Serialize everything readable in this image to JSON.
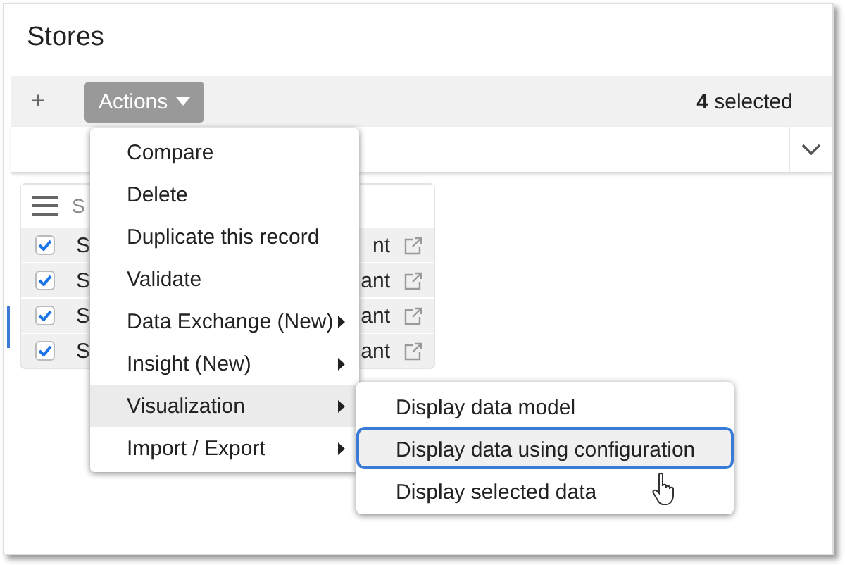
{
  "title": "Stores",
  "toolbar": {
    "add": "+",
    "actions": "Actions",
    "selected": "**4** selected"
  },
  "table": {
    "header": "S",
    "rows": [
      {
        "checked": true,
        "name": "S",
        "type": "nt"
      },
      {
        "checked": true,
        "name": "S",
        "type": "ant"
      },
      {
        "checked": true,
        "name": "S",
        "type": "ant"
      },
      {
        "checked": true,
        "name": "S",
        "type": "ant"
      }
    ]
  },
  "menu": {
    "items": [
      {
        "label": "Compare",
        "submenu": false,
        "selected": false
      },
      {
        "label": "Delete",
        "submenu": false,
        "selected": false
      },
      {
        "label": "Duplicate this record",
        "submenu": false,
        "selected": false
      },
      {
        "label": "Validate",
        "submenu": false,
        "selected": false
      },
      {
        "label": "Data Exchange (New)",
        "submenu": true,
        "selected": false
      },
      {
        "label": "Insight (New)",
        "submenu": true,
        "selected": false
      },
      {
        "label": "Visualization",
        "submenu": true,
        "selected": true
      },
      {
        "label": "Import / Export",
        "submenu": true,
        "selected": false
      }
    ]
  },
  "submenu": {
    "items": [
      {
        "label": "Display data model",
        "selected": false
      },
      {
        "label": "Display data using configuration",
        "selected": true
      },
      {
        "label": "Display selected data",
        "selected": false
      }
    ]
  }
}
